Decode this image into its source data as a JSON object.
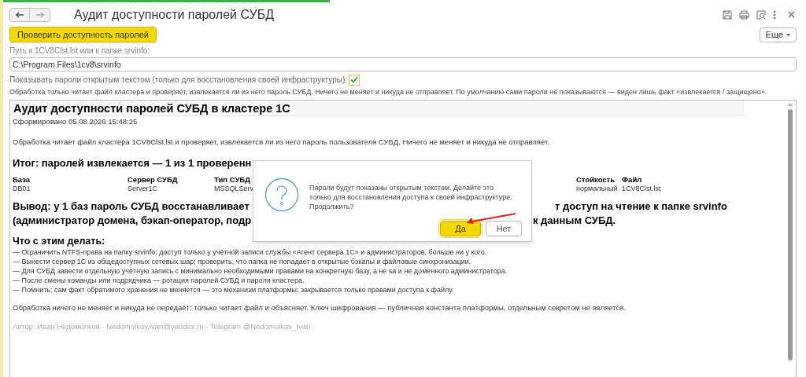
{
  "window": {
    "title": "Аудит доступности паролей СУБД"
  },
  "check_button": "Проверить доступность паролей",
  "more_button": "Еще",
  "path": {
    "label": "Путь к 1CV8Clst.lst или к папке srvinfo:",
    "value": "C:\\Program Files\\1cv8\\srvinfo"
  },
  "show_passwords": {
    "label": "Показывать пароли открытым текстом (только для восстановления своей инфраструктуры):",
    "checked": true
  },
  "info_text": "Обработка только читает файл кластера и проверяет, извлекается ли из него пароль СУБД. Ничего не меняет и никуда не отправляет. По умолчанию сами пароли не показываются — виден лишь факт «извлекается / защищено».",
  "report": {
    "title": "Аудит доступности паролей СУБД в кластере 1С",
    "generated": "Сформировано 05.08.2026 15:48:25",
    "intro": "Обработка читает файл кластера 1CV8Clst.lst и проверяет, извлекается ли из него пароль пользователя СУБД. Ничего не меняет и никуда не отправляет.",
    "summary": "Итог: паролей извлекается — 1 из 1 проверенн",
    "table": {
      "columns": [
        "База",
        "Сервер СУБД",
        "Тип СУБД",
        "Стойкость",
        "Файл"
      ],
      "rows": [
        [
          "DB01",
          "Server1C",
          "MSSQLServ",
          "нормальный",
          "1CV8Clst.lst"
        ]
      ]
    },
    "conclusion": [
      {
        "left": "Вывод: у 1 баз пароль СУБД восстанавливает",
        "right": "т доступ на чтение к папке srvinfo"
      },
      {
        "left": "(администратор домена, бэкап-оператор, подр",
        "right": "к данным СУБД."
      }
    ],
    "todo_title": "Что с этим делать:",
    "todo": [
      "— Ограничить NTFS-права на папку srvinfo: доступ только у учётной записи службы «Агент сервера 1С» и администраторов, больше ни у кого.",
      "— Вынести сервер 1С из общедоступных сетевых шар; проверить, что папка не попадает в открытые бэкапы и файловые синхронизации.",
      "— Для СУБД завести отдельную учётную запись с минимально необходимыми правами на конкретную базу, а не sa и не доменного администратора.",
      "— После смены команды или подрядчика — ротация паролей СУБД и пароля кластера.",
      "— Помнить: сам факт обратимого хранения не меняется — это механизм платформы; закрывается только правами доступа к файлу."
    ],
    "closing": "Обработка ничего не меняет и никуда не передаёт: только читает файл и объясняет. Ключ шифрования — публичная константа платформы, отдельным секретом не является.",
    "author": "Автор: Иван Недомолков · Nedomolkov.ivan@yandex.ru · Telegram @Nedomolkov_Ivan"
  },
  "dialog": {
    "message": "Пароли будут показаны открытым текстом. Делайте это только для восстановления доступа к своей инфраструктуре. Продолжить?",
    "buttons": [
      {
        "label": "Да",
        "default": true
      },
      {
        "label": "Нет",
        "default": false
      }
    ]
  }
}
